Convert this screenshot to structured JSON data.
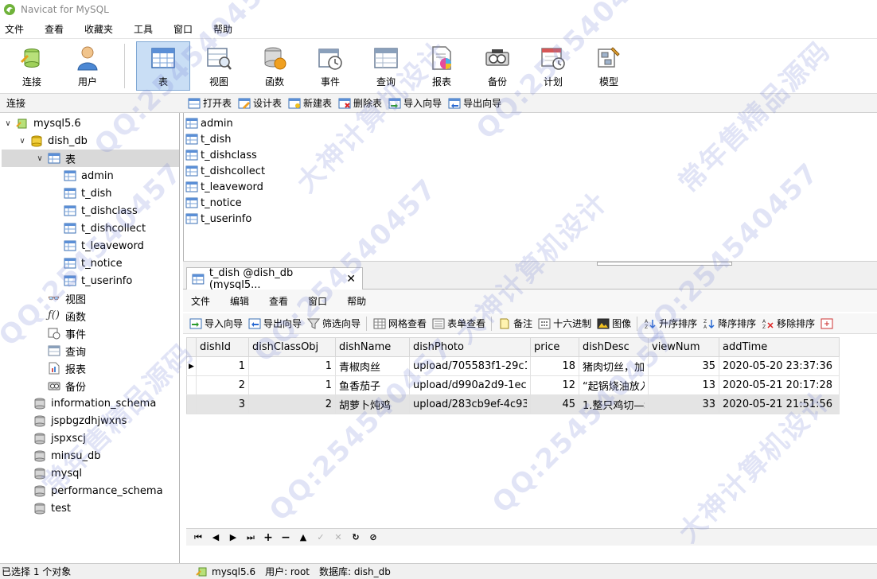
{
  "window": {
    "title": "Navicat for MySQL"
  },
  "menubar": [
    "文件",
    "查看",
    "收藏夹",
    "工具",
    "窗口",
    "帮助"
  ],
  "toolbar": [
    {
      "label": "连接",
      "icon": "connection-icon"
    },
    {
      "label": "用户",
      "icon": "user-icon"
    },
    {
      "label": "表",
      "icon": "table-icon",
      "active": true
    },
    {
      "label": "视图",
      "icon": "view-icon"
    },
    {
      "label": "函数",
      "icon": "function-icon"
    },
    {
      "label": "事件",
      "icon": "event-icon"
    },
    {
      "label": "查询",
      "icon": "query-icon"
    },
    {
      "label": "报表",
      "icon": "report-icon"
    },
    {
      "label": "备份",
      "icon": "backup-icon"
    },
    {
      "label": "计划",
      "icon": "schedule-icon"
    },
    {
      "label": "模型",
      "icon": "model-icon"
    }
  ],
  "connection_header": "连接",
  "object_toolbar": [
    "打开表",
    "设计表",
    "新建表",
    "删除表",
    "导入向导",
    "导出向导"
  ],
  "tree": {
    "connection": "mysql5.6",
    "database": "dish_db",
    "tables_node": "表",
    "tables": [
      "admin",
      "t_dish",
      "t_dishclass",
      "t_dishcollect",
      "t_leaveword",
      "t_notice",
      "t_userinfo"
    ],
    "nodes": [
      "视图",
      "函数",
      "事件",
      "查询",
      "报表",
      "备份"
    ],
    "other_dbs": [
      "information_schema",
      "jspbgzdhjwxns",
      "jspxscj",
      "minsu_db",
      "mysql",
      "performance_schema",
      "test"
    ]
  },
  "object_list": [
    "admin",
    "t_dish",
    "t_dishclass",
    "t_dishcollect",
    "t_leaveword",
    "t_notice",
    "t_userinfo"
  ],
  "tab": {
    "label": "t_dish @dish_db (mysql5...",
    "close": "✕"
  },
  "inner_menu": [
    "文件",
    "编辑",
    "查看",
    "窗口",
    "帮助"
  ],
  "grid_toolbar": [
    "导入向导",
    "导出向导",
    "筛选向导",
    "网格查看",
    "表单查看",
    "备注",
    "十六进制",
    "图像",
    "升序排序",
    "降序排序",
    "移除排序"
  ],
  "grid": {
    "columns": [
      "dishId",
      "dishClassObj",
      "dishName",
      "dishPhoto",
      "price",
      "dishDesc",
      "viewNum",
      "addTime"
    ],
    "rows": [
      [
        "1",
        "1",
        "青椒肉丝",
        "upload/705583f1-29c1",
        "18",
        "猪肉切丝，加,",
        "35",
        "2020-05-20 23:37:36"
      ],
      [
        "2",
        "1",
        "鱼香茄子",
        "upload/d990a2d9-1ec7",
        "12",
        "“起锅烧油放入",
        "13",
        "2020-05-21 20:17:28"
      ],
      [
        "3",
        "2",
        "胡萝卜炖鸡",
        "upload/283cb9ef-4c93",
        "45",
        "1.整只鸡切—‡",
        "33",
        "2020-05-21 21:51:56"
      ]
    ]
  },
  "nav_buttons": [
    "⏮",
    "◀",
    "▶",
    "⏭",
    "+",
    "−",
    "▲",
    "✓",
    "✕",
    "↻",
    "⊘"
  ],
  "status": {
    "selection": "已选择 1 个对象",
    "connection": "mysql5.6",
    "user": "用户: root",
    "database": "数据库: dish_db"
  },
  "watermark": [
    "QQ:254540457",
    "大神计算机设计",
    "常年售精品源码"
  ]
}
